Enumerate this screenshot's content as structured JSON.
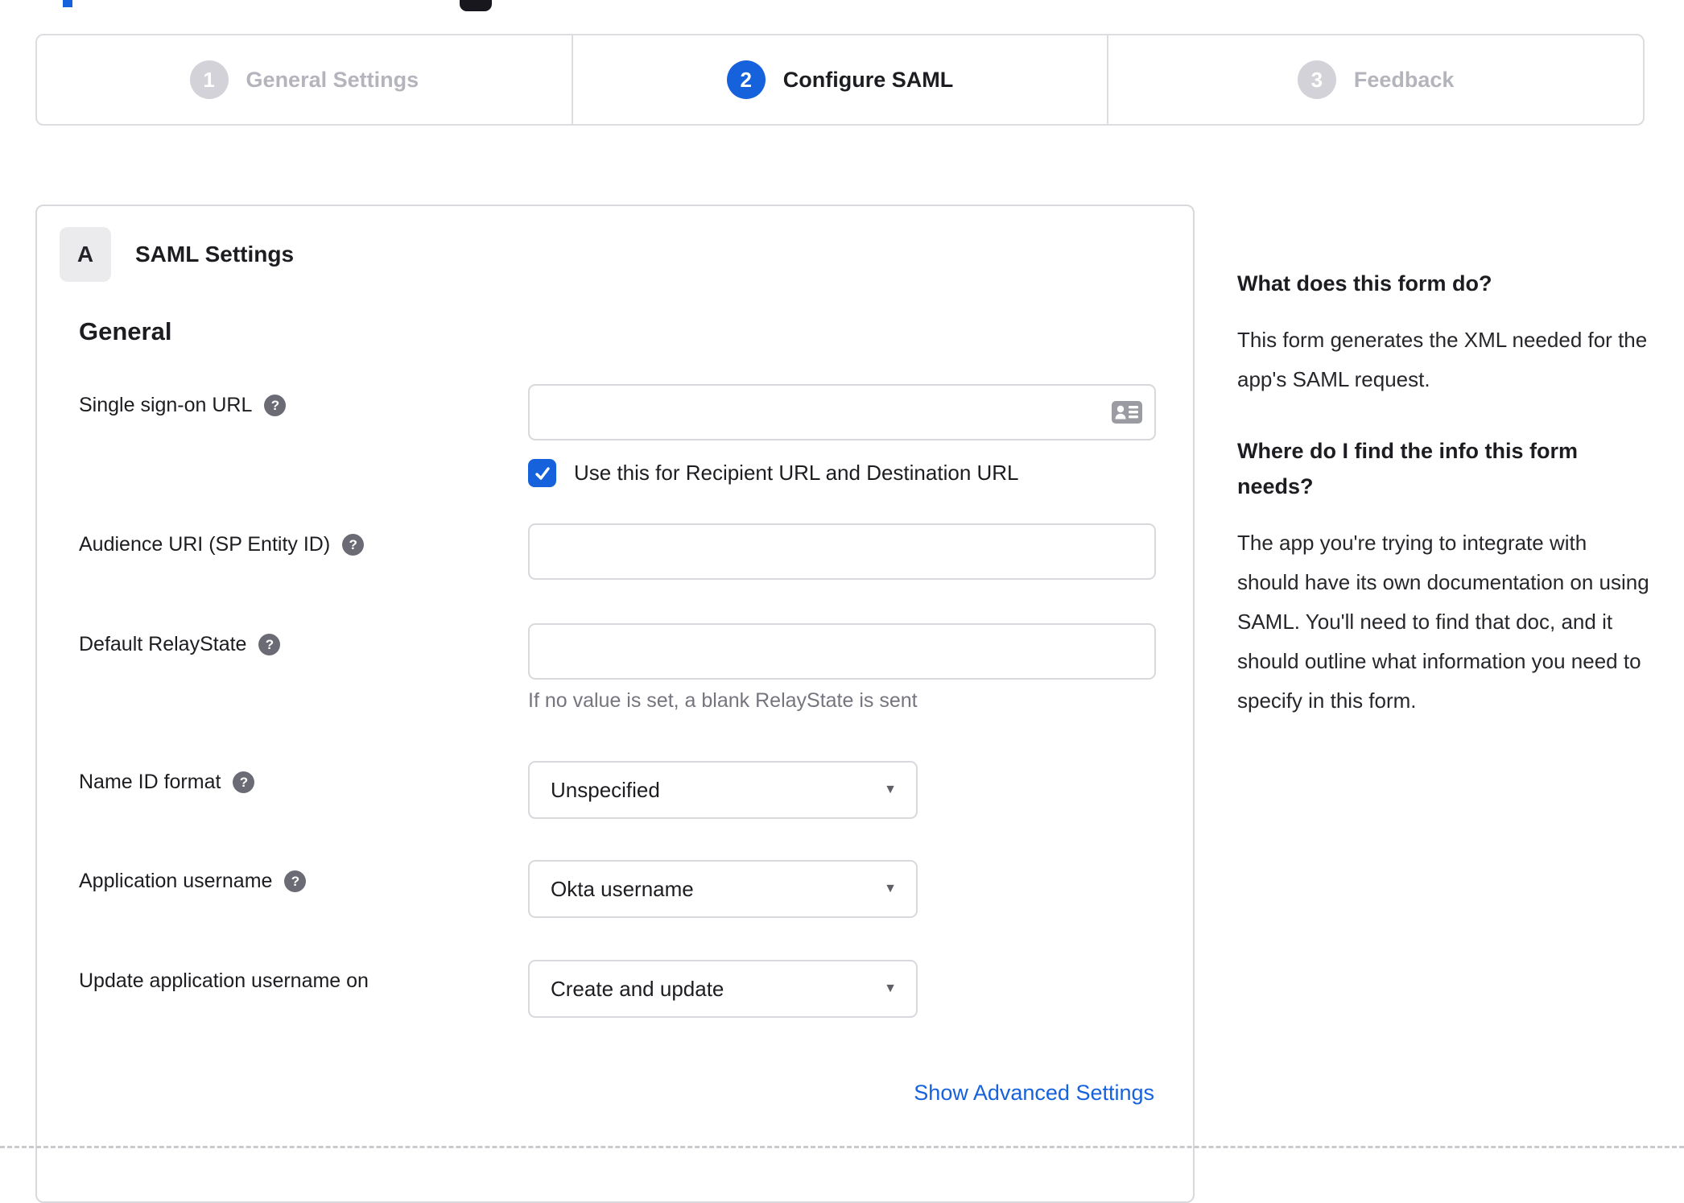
{
  "colors": {
    "accent_blue": "#1662dd",
    "inactive_gray": "#d2d2d8",
    "border_gray": "#d8d8dd",
    "text_dark": "#1d1d21",
    "text_muted": "#75757e"
  },
  "stepper": {
    "steps": [
      {
        "number": "1",
        "label": "General Settings",
        "state": "inactive"
      },
      {
        "number": "2",
        "label": "Configure SAML",
        "state": "active"
      },
      {
        "number": "3",
        "label": "Feedback",
        "state": "inactive"
      }
    ]
  },
  "panel": {
    "section_badge": "A",
    "section_title": "SAML Settings",
    "group_heading": "General",
    "fields": {
      "sso": {
        "label": "Single sign-on URL",
        "value": "",
        "checkbox_label": "Use this for Recipient URL and Destination URL",
        "checkbox_checked": true
      },
      "audience": {
        "label": "Audience URI (SP Entity ID)",
        "value": ""
      },
      "relay": {
        "label": "Default RelayState",
        "value": "",
        "helper": "If no value is set, a blank RelayState is sent"
      },
      "nameid": {
        "label": "Name ID format",
        "value": "Unspecified"
      },
      "appuser": {
        "label": "Application username",
        "value": "Okta username"
      },
      "updateuser": {
        "label": "Update application username on",
        "value": "Create and update"
      }
    },
    "advanced_link": "Show Advanced Settings"
  },
  "sidebar": {
    "sections": [
      {
        "heading": "What does this form do?",
        "body": "This form generates the XML needed for the app's SAML request."
      },
      {
        "heading": "Where do I find the info this form needs?",
        "body": "The app you're trying to integrate with should have its own documentation on using SAML. You'll need to find that doc, and it should outline what information you need to specify in this form."
      }
    ]
  },
  "icons": {
    "help": "?",
    "check": "✓",
    "caret": "▼"
  }
}
